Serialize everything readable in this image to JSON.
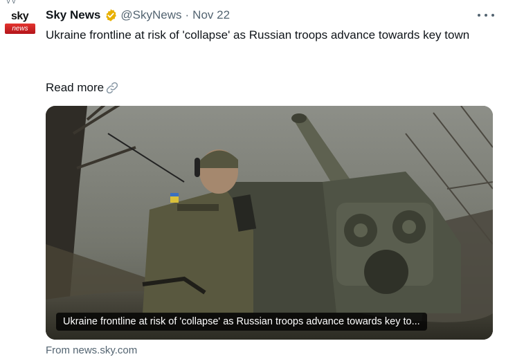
{
  "top": {
    "partial_text": "ᵥ ᵥ"
  },
  "avatar": {
    "line1": "sky",
    "line2": "news"
  },
  "header": {
    "display_name": "Sky News",
    "handle": "@SkyNews",
    "separator": "·",
    "date": "Nov 22"
  },
  "tweet": {
    "text": "Ukraine frontline at risk of 'collapse' as Russian troops advance towards key town",
    "read_more": "Read more"
  },
  "card": {
    "caption": "Ukraine frontline at risk of 'collapse' as Russian troops advance towards key to...",
    "source": "From news.sky.com"
  },
  "colors": {
    "verified_gold": "#e8b000",
    "secondary_text": "#536471",
    "sky_red": "#d5262c"
  },
  "icons": {
    "verified": "verified-badge-icon",
    "more": "more-options-icon",
    "link": "link-icon"
  }
}
